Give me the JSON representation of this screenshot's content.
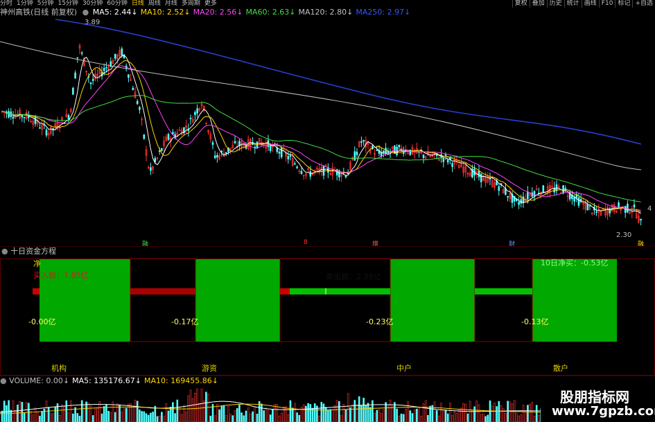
{
  "toolbar": {
    "tabs": [
      "分时",
      "1分钟",
      "5分钟",
      "15分钟",
      "30分钟",
      "60分钟",
      "日线",
      "周线",
      "月线",
      "多周期",
      "更多"
    ],
    "active_tab": "日线",
    "right_buttons": [
      "复权",
      "叠加",
      "历史",
      "统计",
      "画线",
      "F10",
      "标记",
      "+自选"
    ]
  },
  "price_panel": {
    "title": "神州高铁(日线 前复权)",
    "ma": [
      {
        "label": "MA5: 2.44↓",
        "color": "#ffffff"
      },
      {
        "label": "MA10: 2.52↓",
        "color": "#ffd700"
      },
      {
        "label": "MA20: 2.56↓",
        "color": "#ff44ff"
      },
      {
        "label": "MA60: 2.63↓",
        "color": "#44dd44"
      },
      {
        "label": "MA120: 2.80↓",
        "color": "#c0c0c0"
      },
      {
        "label": "MA250: 2.97↓",
        "color": "#3355ff"
      }
    ],
    "high_label": "3.89",
    "low_label": "2.30",
    "right_edge_label": "4",
    "bottom_markers": [
      {
        "text": "融",
        "color": "#44dd44"
      },
      {
        "text": "8",
        "color": "#ff3333"
      },
      {
        "text": "增",
        "color": "#ff6666"
      },
      {
        "text": "财",
        "color": "#6699ff"
      },
      {
        "text": "融",
        "color": "#ffd700"
      }
    ]
  },
  "fund_panel": {
    "title": "十日资金方程",
    "net_label": "净",
    "buy_label": "买入额：1.85亿",
    "sell_label": "卖出额：2.38亿",
    "net10_label": "10日净买：-0.53亿",
    "values": [
      "-0.00亿",
      "-0.17亿",
      "-0.23亿",
      "-0.13亿"
    ],
    "categories": [
      "机构",
      "游资",
      "中户",
      "散户"
    ]
  },
  "volume_panel": {
    "labels": [
      {
        "text": "VOLUME: 0.00↓",
        "color": "#c0c0c0"
      },
      {
        "text": "MA5: 135176.67↓",
        "color": "#ffffff"
      },
      {
        "text": "MA10: 169455.86↓",
        "color": "#ffd700"
      }
    ]
  },
  "watermark": {
    "line1": "股朋指标网",
    "line2": "www.7gpzb.com"
  },
  "colors": {
    "up": "#ff3333",
    "down": "#54ffff",
    "green_block": "#00a800",
    "red_bar": "#aa0000",
    "green_bar": "#00c000"
  }
}
